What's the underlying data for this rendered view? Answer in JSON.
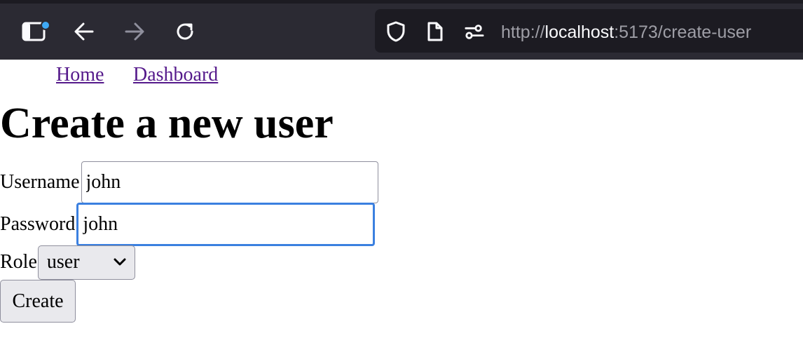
{
  "browser": {
    "url_scheme": "http://",
    "url_host": "localhost",
    "url_rest": ":5173/create-user",
    "icons": [
      "sidebar-icon",
      "back-icon",
      "forward-icon",
      "reload-icon",
      "shield-icon",
      "page-icon",
      "permissions-icon"
    ],
    "badge_color": "#3fa9f5"
  },
  "nav": {
    "home": "Home",
    "dashboard": "Dashboard",
    "link_color": "#551a8b"
  },
  "page": {
    "title": "Create a new user"
  },
  "form": {
    "username_label": "Username",
    "username_value": "john",
    "password_label": "Password",
    "password_value": "john",
    "role_label": "Role",
    "role_value": "user",
    "submit_label": "Create",
    "focus_color": "#3b80e0"
  }
}
